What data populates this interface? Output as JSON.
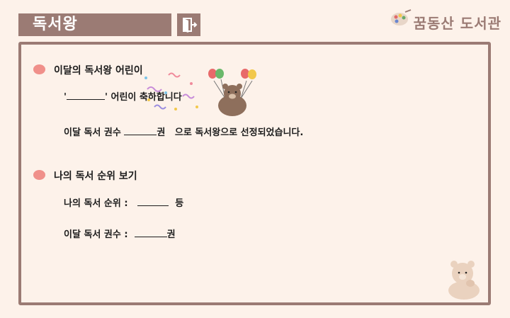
{
  "header": {
    "title": "독서왕",
    "exit_icon": "door-exit-icon",
    "brand_name": "꿈동산 도서관",
    "brand_icon": "palette-icon"
  },
  "section_king": {
    "heading": "이달의 독서왕 어린이",
    "congrats": {
      "quote_open": "'",
      "quote_close": "' 어린이 축하합니다"
    },
    "result": {
      "prefix": "이달 독서 권수",
      "unit": "권",
      "suffix": "으로 독서왕으로 선정되었습니다."
    }
  },
  "section_rank": {
    "heading": "나의 독서 순위 보기",
    "rank_row": {
      "label": "나의 독서 순위 :",
      "unit": "등"
    },
    "count_row": {
      "label": "이달 독서 권수 :",
      "unit": "권"
    }
  },
  "colors": {
    "accent": "#9b7b74",
    "background": "#fdf2ea",
    "bullet": "#f0908a"
  },
  "decorations": [
    "bear-with-balloons-icon",
    "confetti-icon",
    "bear-sitting-icon"
  ]
}
